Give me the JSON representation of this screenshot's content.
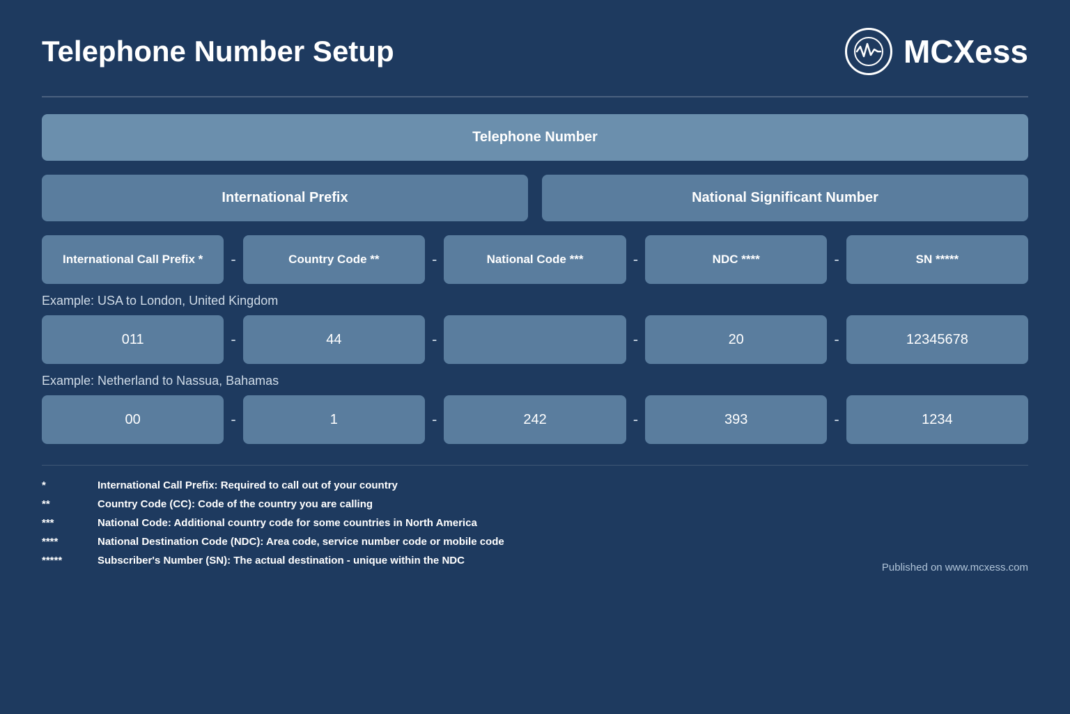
{
  "header": {
    "title": "Telephone Number Setup",
    "logo_text": "MCXess"
  },
  "telephone_number_label": "Telephone Number",
  "international_prefix_label": "International Prefix",
  "national_significant_number_label": "National Significant Number",
  "columns": {
    "icp": "International Call Prefix *",
    "cc": "Country Code **",
    "nc": "National Code ***",
    "ndc": "NDC ****",
    "sn": "SN *****"
  },
  "example1": {
    "label": "Example: USA to London, United Kingdom",
    "icp": "011",
    "cc": "44",
    "nc": "",
    "ndc": "20",
    "sn": "12345678"
  },
  "example2": {
    "label": "Example: Netherland to Nassua, Bahamas",
    "icp": "00",
    "cc": "1",
    "nc": "242",
    "ndc": "393",
    "sn": "1234"
  },
  "notes": [
    {
      "star": "*",
      "text": "International Call Prefix: Required to call out of your country"
    },
    {
      "star": "**",
      "text": "Country Code (CC): Code of the country you are calling"
    },
    {
      "star": "***",
      "text": "National Code: Additional country code for some countries in North America"
    },
    {
      "star": "****",
      "text": "National Destination Code (NDC): Area code, service number code or mobile code"
    },
    {
      "star": "*****",
      "text": "Subscriber's Number (SN): The actual destination - unique within the NDC"
    }
  ],
  "published": "Published on www.mcxess.com"
}
